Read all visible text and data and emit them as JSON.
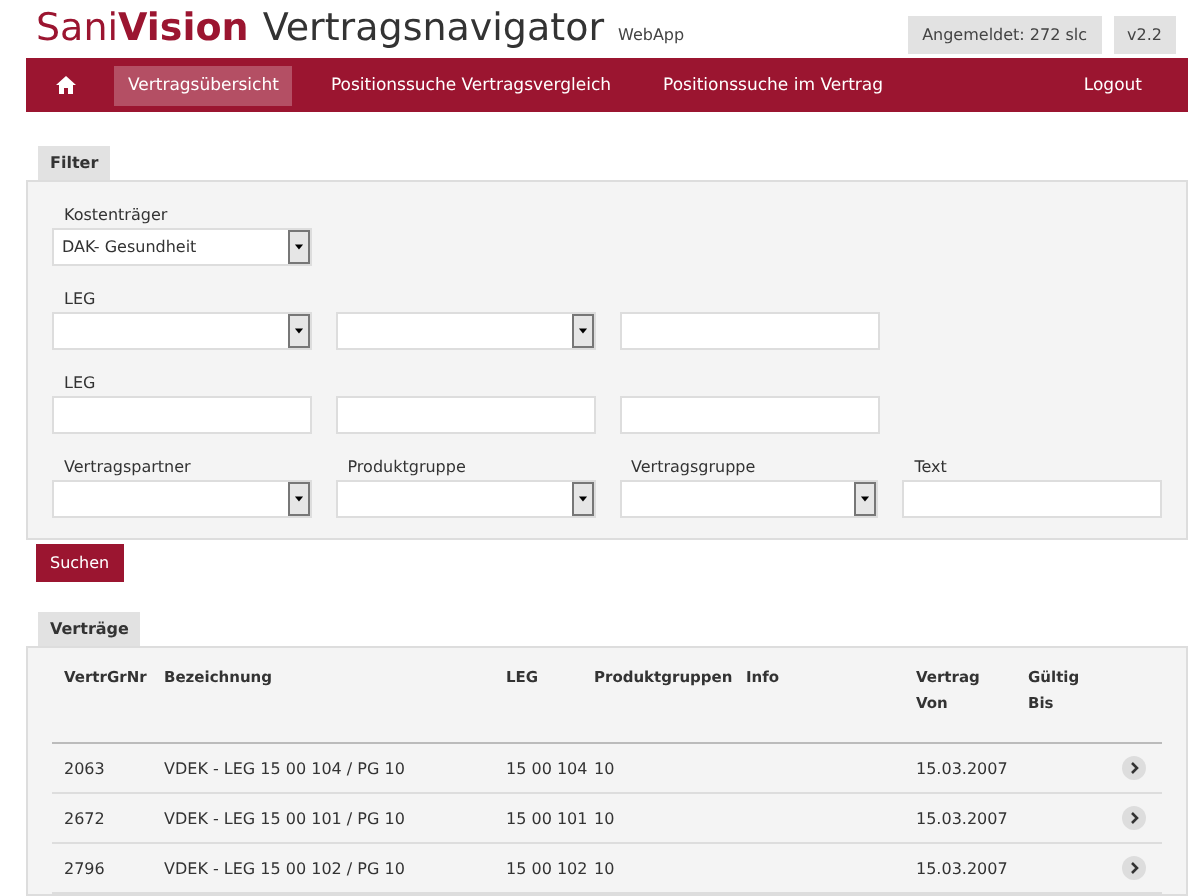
{
  "header": {
    "brand_first": "Sani",
    "brand_second": "Vision",
    "title": "Vertragsnavigator",
    "suffix": "WebApp",
    "badges": [
      "Angemeldet: 272 slc",
      "v2.2"
    ]
  },
  "nav": {
    "items": [
      {
        "kind": "home",
        "selected": false
      },
      {
        "kind": "text",
        "label": "Vertragsübersicht",
        "selected": true
      },
      {
        "kind": "text",
        "label": "Positionssuche Vertragsvergleich",
        "selected": false
      },
      {
        "kind": "text",
        "label": "Positionssuche im Vertrag",
        "selected": false
      }
    ],
    "logout": "Logout"
  },
  "filter": {
    "tab": "Filter",
    "rows": [
      {
        "fields": [
          {
            "kind": "select",
            "label": "Kostenträger",
            "value": "DAK- Gesundheit"
          }
        ]
      },
      {
        "fields": [
          {
            "kind": "select",
            "label": "LEG"
          },
          {
            "kind": "select"
          },
          {
            "kind": "text"
          }
        ]
      },
      {
        "fields": [
          {
            "kind": "text",
            "label": "LEG"
          },
          {
            "kind": "text"
          },
          {
            "kind": "text"
          }
        ]
      },
      {
        "fields": [
          {
            "kind": "select",
            "label": "Vertragspartner"
          },
          {
            "kind": "select",
            "label": "Produktgruppe"
          },
          {
            "kind": "select",
            "label": "Vertragsgruppe"
          },
          {
            "kind": "text",
            "label": "Text"
          }
        ]
      }
    ],
    "button": "Suchen"
  },
  "contracts": {
    "tab": "Verträge",
    "columns": [
      [
        "VertrGrNr"
      ],
      [
        "Bezeichnung"
      ],
      [
        "LEG"
      ],
      [
        "Produktgruppen"
      ],
      [
        "Info"
      ],
      [
        "Vertrag",
        "Von"
      ],
      [
        "Gültig",
        "Bis"
      ]
    ],
    "rows": [
      {
        "nr": "2063",
        "bezeichnung": "VDEK - LEG 15 00 104 / PG 10",
        "leg": "15 00 104",
        "produktgruppen": "10",
        "vertrag_von": "15.03.2007"
      },
      {
        "nr": "2672",
        "bezeichnung": "VDEK - LEG 15 00 101 / PG 10",
        "leg": "15 00 101",
        "produktgruppen": "10",
        "vertrag_von": "15.03.2007"
      },
      {
        "nr": "2796",
        "bezeichnung": "VDEK - LEG 15 00 102 / PG 10",
        "leg": "15 00 102",
        "produktgruppen": "10",
        "vertrag_von": "15.03.2007"
      }
    ]
  }
}
